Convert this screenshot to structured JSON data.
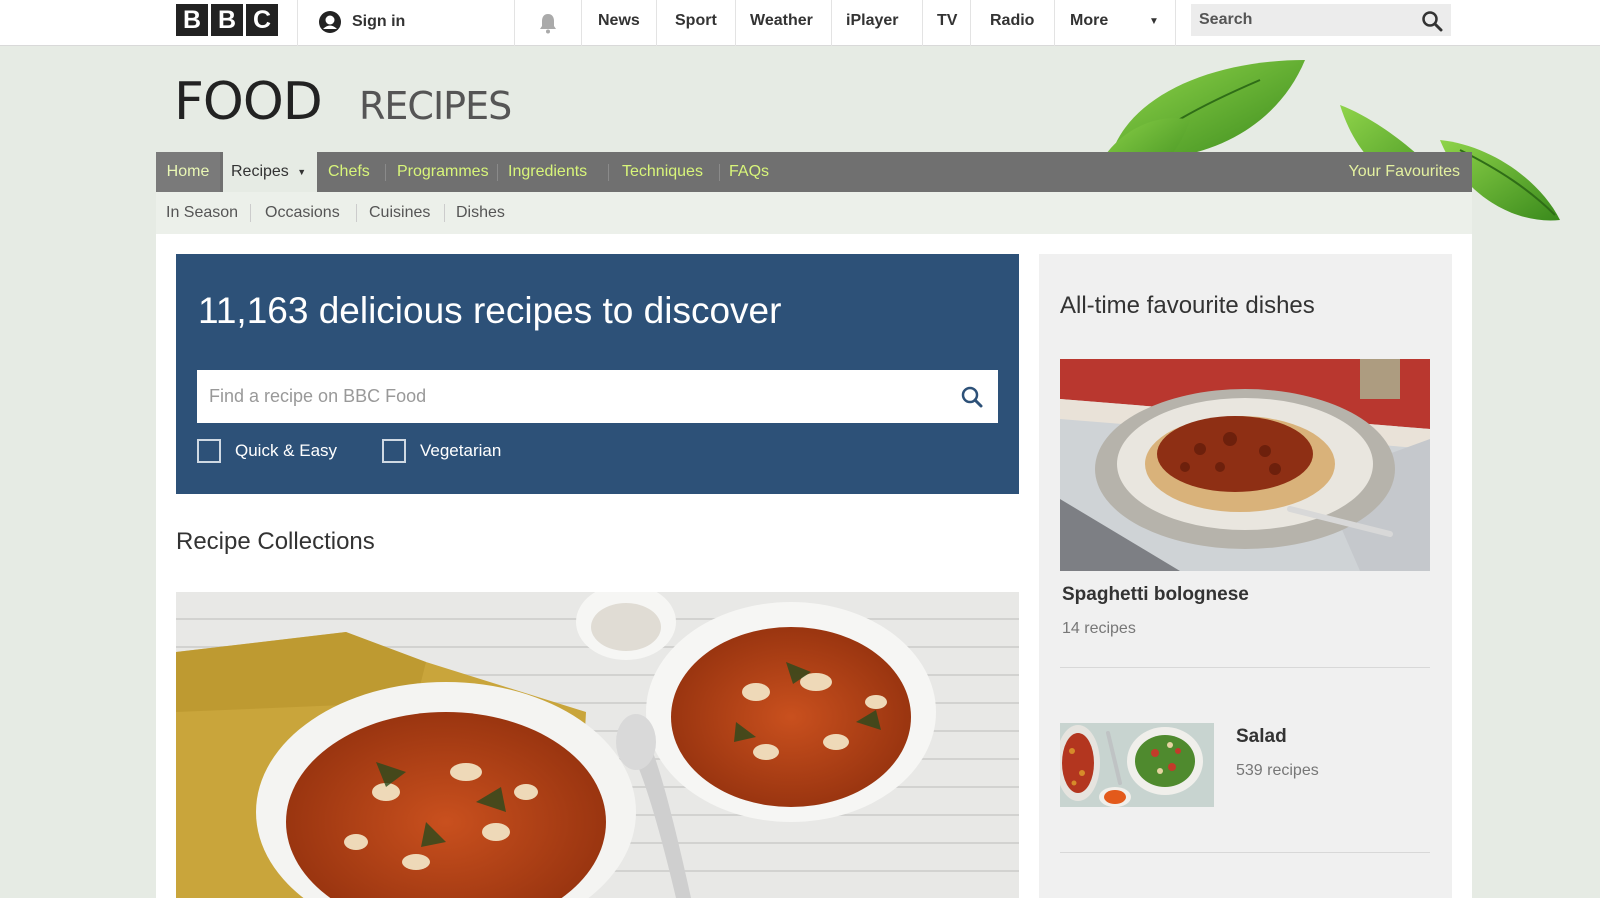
{
  "topbar": {
    "logo_letters": [
      "B",
      "B",
      "C"
    ],
    "signin_label": "Sign in",
    "nav": [
      "News",
      "Sport",
      "Weather",
      "iPlayer",
      "TV",
      "Radio",
      "More"
    ],
    "search_placeholder": "Search",
    "icons": {
      "user": "user-icon",
      "bell": "bell-icon",
      "search": "search-icon",
      "caret": "chevron-down-icon"
    }
  },
  "header": {
    "title": "FOOD",
    "subtitle": "RECIPES"
  },
  "mainnav": {
    "home": "Home",
    "recipes": "Recipes",
    "items": [
      "Chefs",
      "Programmes",
      "Ingredients",
      "Techniques",
      "FAQs"
    ],
    "favourites": "Your Favourites"
  },
  "subnav": {
    "items": [
      "In Season",
      "Occasions",
      "Cuisines",
      "Dishes"
    ]
  },
  "hero": {
    "headline": "11,163 delicious recipes to discover",
    "search_placeholder": "Find a recipe on BBC Food",
    "filters": [
      {
        "label": "Quick & Easy",
        "checked": false
      },
      {
        "label": "Vegetarian",
        "checked": false
      }
    ]
  },
  "collections": {
    "title": "Recipe Collections"
  },
  "sidebar": {
    "title": "All-time favourite dishes",
    "dishes": [
      {
        "name": "Spaghetti bolognese",
        "count": "14 recipes"
      },
      {
        "name": "Salad",
        "count": "539 recipes"
      }
    ]
  },
  "colors": {
    "hero_blue": "#2d5178",
    "nav_grey": "#707070",
    "nav_link_green": "#d8f57a",
    "page_bg": "#e6ebe4"
  }
}
